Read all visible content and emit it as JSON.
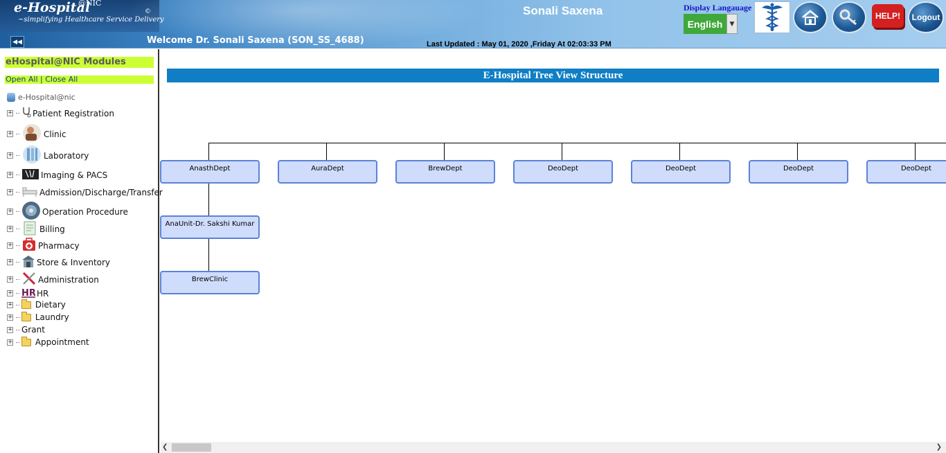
{
  "header": {
    "logo_title": "e-Hospital",
    "logo_sup": "@NIC",
    "logo_copyright": "©",
    "logo_tagline": "~simplifying Healthcare Service Delivery",
    "welcome": "Welcome Dr. Sonali Saxena (SON_SS_4688)",
    "last_updated": "Last Updated : May 01, 2020 ,Friday At 02:03:33 PM",
    "user_name": "Sonali Saxena",
    "language_label": "Display Langauage",
    "language_value": "English",
    "help_label": "HELP!",
    "logout_label": "Logout",
    "collapse_icon": "double-left-arrow-icon"
  },
  "sidebar": {
    "title": "eHospital@NIC Modules",
    "open_all": "Open All",
    "separator": "|",
    "close_all": "Close All",
    "root_label": "e-Hospital@nic",
    "items": [
      {
        "label": "Patient Registration",
        "icon": "stethoscope-icon"
      },
      {
        "label": "Clinic",
        "icon": "doctor-icon"
      },
      {
        "label": "Laboratory",
        "icon": "lab-icon"
      },
      {
        "label": "Imaging & PACS",
        "icon": "xray-icon"
      },
      {
        "label": "Admission/Discharge/Transfer",
        "icon": "bed-icon"
      },
      {
        "label": "Operation Procedure",
        "icon": "globe-icon"
      },
      {
        "label": "Billing",
        "icon": "bill-icon"
      },
      {
        "label": "Pharmacy",
        "icon": "first-aid-icon"
      },
      {
        "label": "Store & Inventory",
        "icon": "store-icon"
      },
      {
        "label": "Administration",
        "icon": "tools-icon"
      },
      {
        "label": "HR",
        "icon": "hr-icon"
      },
      {
        "label": "Dietary",
        "icon": "folder-icon"
      },
      {
        "label": "Laundry",
        "icon": "folder-icon"
      },
      {
        "label": "Grant",
        "icon": ""
      },
      {
        "label": "Appointment",
        "icon": "folder-icon"
      }
    ]
  },
  "main": {
    "title": "E-Hospital Tree View Structure",
    "departments": [
      "AnasthDept",
      "AuraDept",
      "BrewDept",
      "DeoDept",
      "DeoDept",
      "DeoDept",
      "DeoDept"
    ],
    "sub_units": [
      "AnaUnit-Dr. Sakshi Kumar",
      "BrewClinic"
    ]
  }
}
